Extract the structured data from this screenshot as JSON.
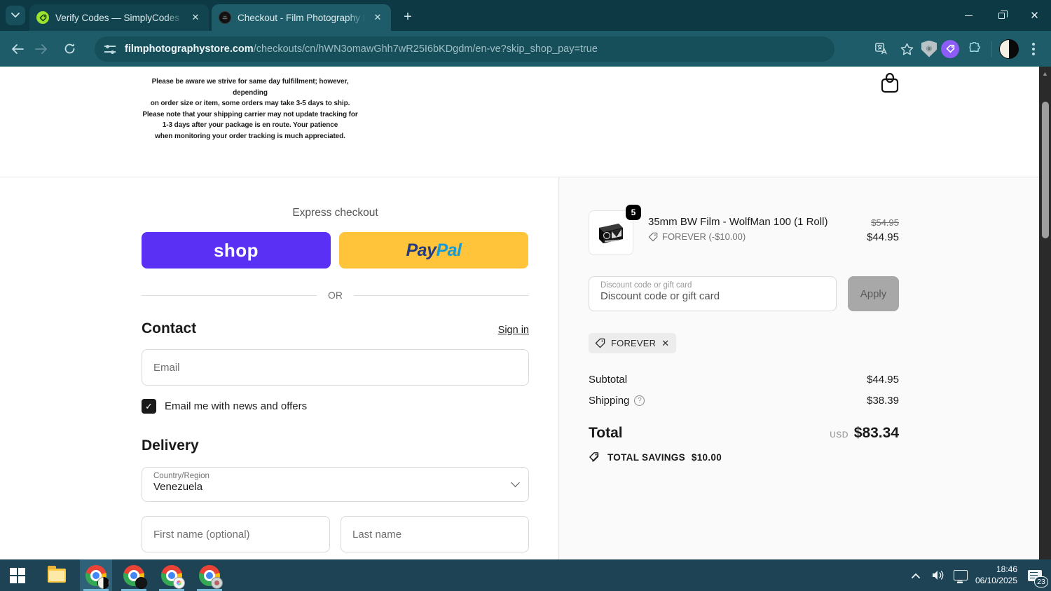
{
  "browser": {
    "tab_search_icon": "v",
    "tabs": [
      {
        "title": "Verify Codes — SimplyCodes",
        "close": "✕"
      },
      {
        "title": "Checkout - Film Photography P",
        "close": "✕"
      }
    ],
    "new_tab": "+",
    "nav": {
      "back": "←",
      "forward": "→",
      "reload": "⟳"
    },
    "url": {
      "domain": "filmphotographystore.com",
      "path": "/checkouts/cn/hWN3omawGhh7wR25I6bKDgdm/en-ve?skip_shop_pay=true"
    }
  },
  "page": {
    "shipping_note": "Please be aware we strive for same day fulfillment; however, depending\non order size or item, some orders may take 3-5 days to ship.\nPlease note that your shipping carrier may not update tracking for\n1-3 days after your package is en route. Your patience\nwhen monitoring your order tracking is much appreciated.",
    "express": {
      "heading": "Express checkout",
      "shop_label": "shop",
      "paypal_pay": "Pay",
      "paypal_pal": "Pal",
      "or": "OR"
    },
    "contact": {
      "heading": "Contact",
      "signin": "Sign in",
      "email_placeholder": "Email",
      "newsletter_label": "Email me with news and offers",
      "checkbox_checked": "✓"
    },
    "delivery": {
      "heading": "Delivery",
      "country_label": "Country/Region",
      "country_value": "Venezuela",
      "first_name_placeholder": "First name (optional)",
      "last_name_placeholder": "Last name"
    }
  },
  "summary": {
    "item": {
      "quantity": "5",
      "title": "35mm BW Film - WolfMan 100 (1 Roll)",
      "discount_tag": "FOREVER (-$10.00)",
      "original_price": "$54.95",
      "price": "$44.95"
    },
    "discount": {
      "label": "Discount code or gift card",
      "placeholder": "Discount code or gift card",
      "apply": "Apply",
      "chip": "FOREVER",
      "chip_close": "✕"
    },
    "totals": {
      "subtotal_label": "Subtotal",
      "subtotal": "$44.95",
      "shipping_label": "Shipping",
      "shipping_help": "?",
      "shipping": "$38.39",
      "total_label": "Total",
      "currency": "USD",
      "total": "$83.34",
      "savings_label": "TOTAL SAVINGS",
      "savings": "$10.00"
    }
  },
  "taskbar": {
    "time": "18:46",
    "date": "06/10/2025",
    "notification_count": "23"
  },
  "colors": {
    "shop_purple": "#5a31f4",
    "paypal_yellow": "#ffc439",
    "paypal_navy": "#253b80",
    "paypal_blue": "#179bd7",
    "browser_theme": "#1e5c69",
    "titlebar": "#0c3943",
    "taskbar": "#1d4355"
  }
}
